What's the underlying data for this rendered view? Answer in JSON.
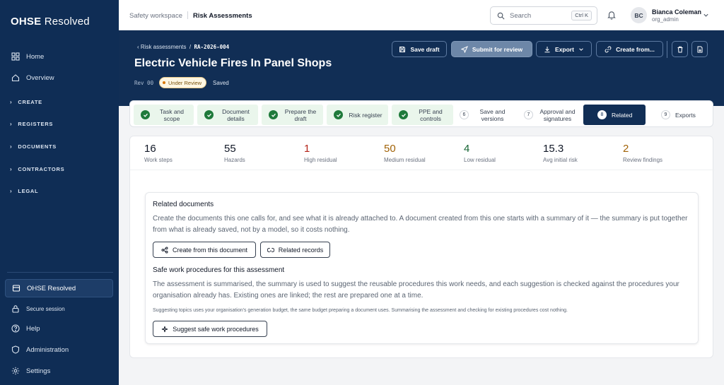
{
  "brand": {
    "logo_strong": "OHSE",
    "logo_light": "Resolved"
  },
  "sidebar": {
    "home": "Home",
    "overview": "Overview",
    "groups": [
      "CREATE",
      "REGISTERS",
      "DOCUMENTS",
      "CONTRACTORS",
      "LEGAL"
    ],
    "org": "OHSE Resolved",
    "secure": "Secure session",
    "help": "Help",
    "administration": "Administration",
    "settings": "Settings"
  },
  "topbar": {
    "workspace": "Safety workspace",
    "section": "Risk Assessments",
    "search_label": "Search",
    "search_shortcut": "Ctrl K",
    "user_initials": "BC",
    "user_name": "Bianca Coleman",
    "user_role": "org_admin"
  },
  "header": {
    "back_label": "Risk assessments",
    "crumb_sep": "/",
    "doc_code": "RA-2026-004",
    "title": "Electric Vehicle Fires In Panel Shops",
    "revision": "Rev 00",
    "status": "Under Review",
    "save_state": "Saved",
    "buttons": {
      "save_draft": "Save draft",
      "submit": "Submit for review",
      "export": "Export",
      "create_from": "Create from..."
    }
  },
  "steps": [
    {
      "label": "Task and scope",
      "state": "done"
    },
    {
      "label": "Document details",
      "state": "done"
    },
    {
      "label": "Prepare the draft",
      "state": "done"
    },
    {
      "label": "Risk register",
      "state": "done"
    },
    {
      "label": "PPE and controls",
      "state": "done"
    },
    {
      "num": "6",
      "label": "Save and versions",
      "state": "todo"
    },
    {
      "num": "7",
      "label": "Approval and signatures",
      "state": "todo"
    },
    {
      "num": "8",
      "label": "Related",
      "state": "active"
    },
    {
      "num": "9",
      "label": "Exports",
      "state": "todo"
    }
  ],
  "stats": [
    {
      "value": "16",
      "label": "Work steps",
      "color": "#111827"
    },
    {
      "value": "55",
      "label": "Hazards",
      "color": "#111827"
    },
    {
      "value": "1",
      "label": "High residual",
      "color": "#b42318"
    },
    {
      "value": "50",
      "label": "Medium residual",
      "color": "#a16207"
    },
    {
      "value": "4",
      "label": "Low residual",
      "color": "#166534"
    },
    {
      "value": "15.3",
      "label": "Avg initial risk",
      "color": "#111827"
    },
    {
      "value": "2",
      "label": "Review findings",
      "color": "#a16207"
    }
  ],
  "related": {
    "title": "Related documents",
    "description": "Create the documents this one calls for, and see what it is already attached to. A document created from this one starts with a summary of it — the summary is put together from what is already saved, not by a model, so it costs nothing.",
    "create_button": "Create from this document",
    "records_button": "Related records"
  },
  "swp": {
    "title": "Safe work procedures for this assessment",
    "description": "The assessment is summarised, the summary is used to suggest the reusable procedures this work needs, and each suggestion is checked against the procedures your organisation already has. Existing ones are linked; the rest are prepared one at a time.",
    "note": "Suggesting topics uses your organisation's generation budget, the same budget preparing a document uses. Summarising the assessment and checking for existing procedures cost nothing.",
    "suggest_button": "Suggest safe work procedures"
  }
}
